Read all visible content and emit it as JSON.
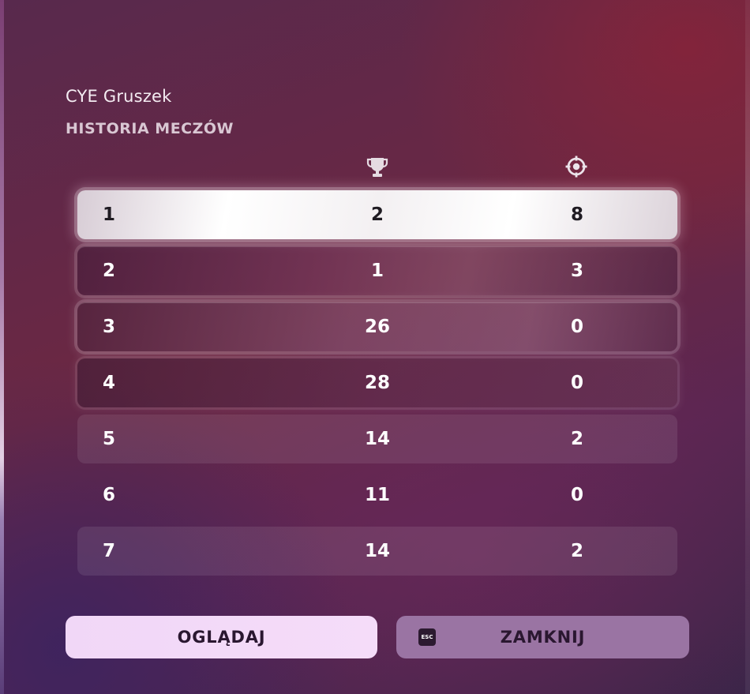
{
  "player": {
    "name": "CYE Gruszek"
  },
  "section": {
    "title": "HISTORIA MECZÓW"
  },
  "columns": {
    "placement_icon": "trophy-icon",
    "kills_icon": "crosshair-icon"
  },
  "matches": [
    {
      "num": "1",
      "placement": "2",
      "kills": "8"
    },
    {
      "num": "2",
      "placement": "1",
      "kills": "3"
    },
    {
      "num": "3",
      "placement": "26",
      "kills": "0"
    },
    {
      "num": "4",
      "placement": "28",
      "kills": "0"
    },
    {
      "num": "5",
      "placement": "14",
      "kills": "2"
    },
    {
      "num": "6",
      "placement": "11",
      "kills": "0"
    },
    {
      "num": "7",
      "placement": "14",
      "kills": "2"
    }
  ],
  "selected_match": "1",
  "buttons": {
    "watch_label": "OGLĄDAJ",
    "close_label": "ZAMKNIJ",
    "close_key": "ESC"
  },
  "colors": {
    "watch_button": "#f3d9f8",
    "close_button": "#9a74a3",
    "selected_row": "#ffffff"
  }
}
